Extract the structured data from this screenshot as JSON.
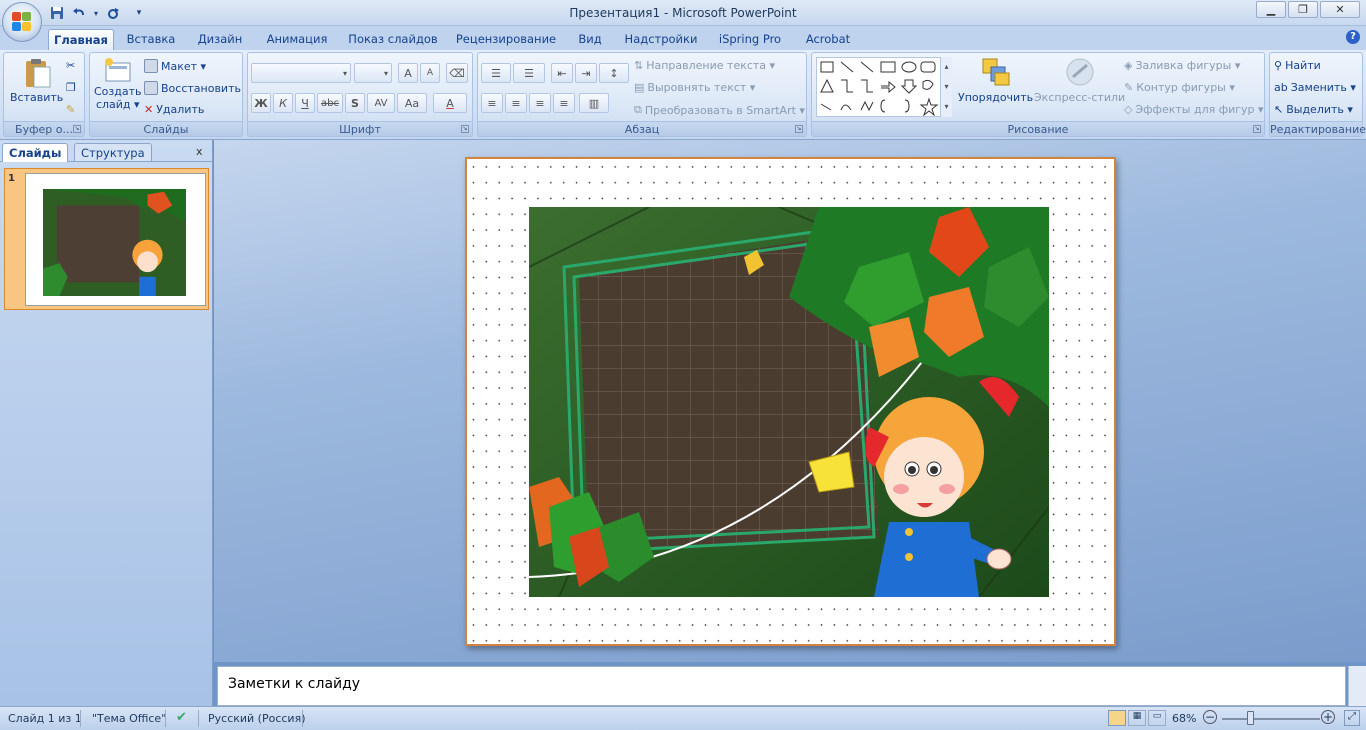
{
  "window": {
    "title": "Презентация1 - Microsoft PowerPoint",
    "controls": {
      "minimize": "▁",
      "restore": "❐",
      "close": "✕"
    }
  },
  "quick_access": {
    "save": "save-icon",
    "undo": "undo-icon",
    "redo": "redo-icon",
    "more": "▾"
  },
  "tabs": [
    {
      "label": "Главная",
      "active": true
    },
    {
      "label": "Вставка"
    },
    {
      "label": "Дизайн"
    },
    {
      "label": "Анимация"
    },
    {
      "label": "Показ слайдов"
    },
    {
      "label": "Рецензирование"
    },
    {
      "label": "Вид"
    },
    {
      "label": "Надстройки"
    },
    {
      "label": "iSpring Pro"
    },
    {
      "label": "Acrobat"
    }
  ],
  "help": "?",
  "ribbon": {
    "clipboard": {
      "label": "Буфер о...",
      "paste": "Вставить"
    },
    "slides": {
      "label": "Слайды",
      "new_slide_line1": "Создать",
      "new_slide_line2": "слайд ▾",
      "layout": "Макет ▾",
      "reset": "Восстановить",
      "delete": "Удалить"
    },
    "font": {
      "label": "Шрифт",
      "bold": "Ж",
      "italic": "К",
      "underline": "Ч",
      "strike": "abc",
      "shadow": "S",
      "spacing": "AV",
      "case": "Aa",
      "color": "A",
      "grow": "A",
      "shrink": "A"
    },
    "paragraph": {
      "label": "Абзац",
      "text_direction": "Направление текста ▾",
      "align_text": "Выровнять текст ▾",
      "smartart": "Преобразовать в SmartArt ▾"
    },
    "drawing": {
      "label": "Рисование",
      "arrange": "Упорядочить",
      "quick_styles": "Экспресс-стили",
      "fill": "Заливка фигуры ▾",
      "outline": "Контур фигуры ▾",
      "effects": "Эффекты для фигур ▾"
    },
    "editing": {
      "label": "Редактирование",
      "find": "Найти",
      "replace": "Заменить ▾",
      "select": "Выделить ▾"
    }
  },
  "left_pane": {
    "tab_slides": "Слайды",
    "tab_outline": "Структура",
    "close": "x",
    "slide_number": "1"
  },
  "notes": {
    "placeholder": "Заметки к слайду"
  },
  "status": {
    "slide": "Слайд 1 из 1",
    "theme": "\"Тема Office\"",
    "language": "Русский (Россия)",
    "zoom": "68%",
    "zoom_level": 0.68
  },
  "colors": {
    "accent": "#d2833f",
    "ribbon": "#d2e1f5",
    "frame_green": "#2e7d32"
  }
}
